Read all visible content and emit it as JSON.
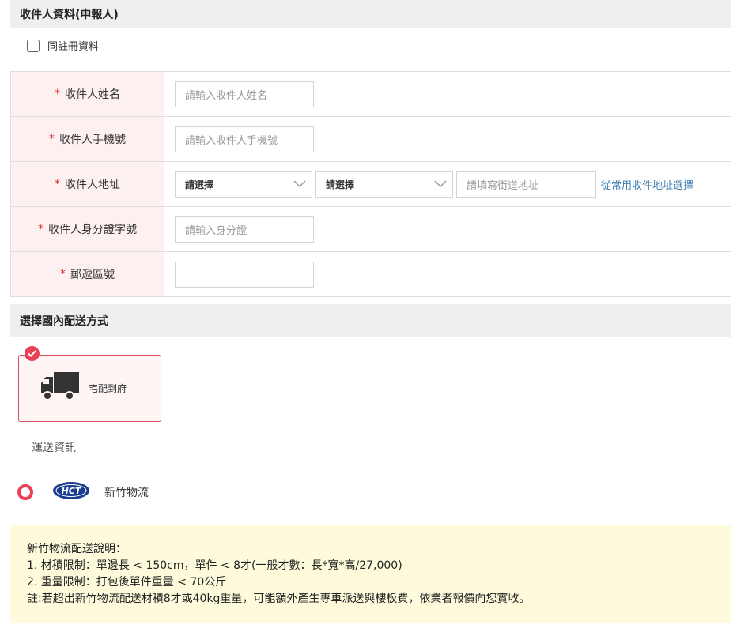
{
  "recipient_section": {
    "title": "收件人資料(申報人)",
    "same_as_registered_label": "同註冊資料",
    "fields": {
      "name": {
        "label": "收件人姓名",
        "placeholder": "請輸入收件人姓名",
        "value": ""
      },
      "phone": {
        "label": "收件人手機號",
        "placeholder": "請輸入收件人手機號",
        "value": ""
      },
      "address": {
        "label": "收件人地址",
        "city_select": "請選擇",
        "district_select": "請選擇",
        "street_placeholder": "請填寫街道地址",
        "common_address_link": "從常用收件地址選擇"
      },
      "id_number": {
        "label": "收件人身分證字號",
        "placeholder": "請輸入身分證",
        "value": ""
      },
      "postal_code": {
        "label": "郵遞區號",
        "placeholder": "",
        "value": ""
      }
    },
    "required_mark": "*"
  },
  "delivery_section": {
    "title": "選擇國內配送方式",
    "option": {
      "label": "宅配到府",
      "icon": "truck-icon",
      "selected": true
    },
    "shipping_info_label": "運送資訊",
    "carrier": {
      "name": "新竹物流",
      "logo_text": "HCT",
      "selected": true
    }
  },
  "notice": {
    "lines": [
      "新竹物流配送說明：",
      "1. 材積限制：單邊長 < 150cm，單件 < 8才(一般才數：長*寬*高/27,000)",
      "2. 重量限制：打包後單件重量 < 70公斤",
      "註:若超出新竹物流配送材積8才或40kg重量，可能額外產生專車派送與樓板費，依業者報價向您實收。"
    ]
  },
  "colors": {
    "accent": "#e84156",
    "label_bg": "#fdf0f0",
    "notice_bg": "#fefbdc",
    "link": "#3e7bb0"
  }
}
